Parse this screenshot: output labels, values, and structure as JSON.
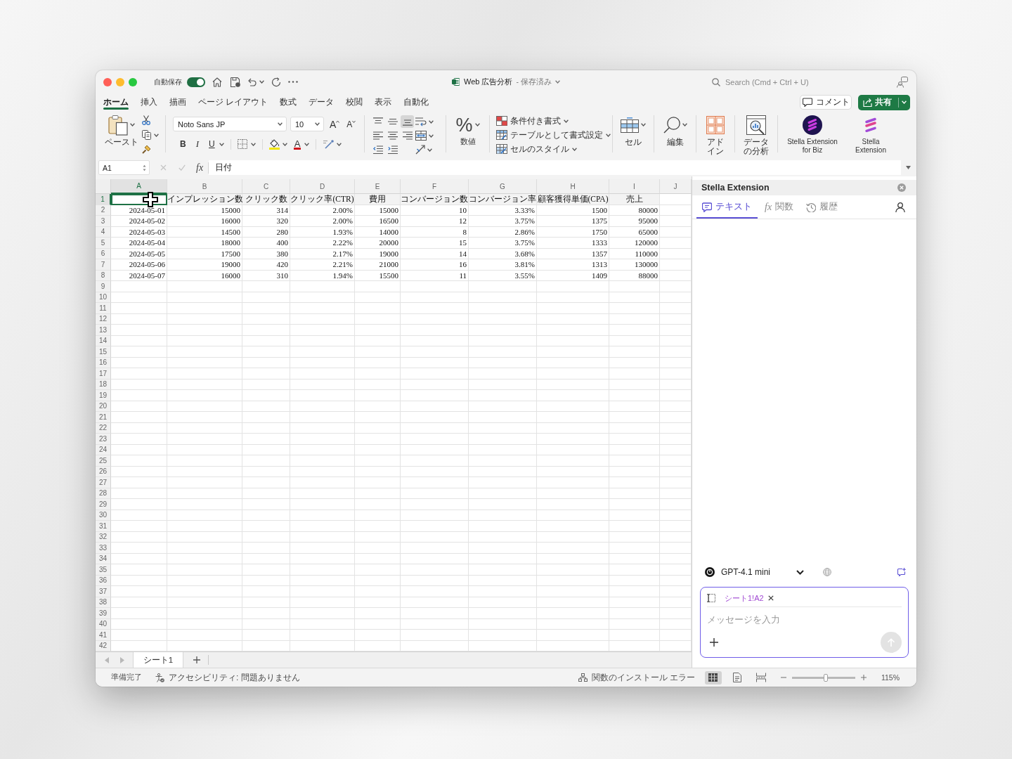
{
  "window": {
    "title": "Web 広告分析",
    "save_status": "- 保存済み",
    "autosave": {
      "label": "自動保存",
      "on": true
    },
    "search": {
      "placeholder": "Search (Cmd + Ctrl + U)"
    }
  },
  "ribbon_tabs": [
    {
      "label": "ホーム",
      "selected": true
    },
    {
      "label": "挿入",
      "selected": false
    },
    {
      "label": "描画",
      "selected": false
    },
    {
      "label": "ページ レイアウト",
      "selected": false
    },
    {
      "label": "数式",
      "selected": false
    },
    {
      "label": "データ",
      "selected": false
    },
    {
      "label": "校閲",
      "selected": false
    },
    {
      "label": "表示",
      "selected": false
    },
    {
      "label": "自動化",
      "selected": false
    }
  ],
  "comment_button": {
    "label": "コメント"
  },
  "share_button": {
    "label": "共有"
  },
  "ribbon": {
    "paste": {
      "label": "ペースト"
    },
    "font": {
      "name": "Noto Sans JP",
      "size": "10",
      "grow": "A",
      "shrink": "A",
      "bold": "B",
      "italic": "I",
      "underline": "U",
      "paint_letter": "A"
    },
    "vertical_align": [
      {
        "kind": "top",
        "selected": false
      },
      {
        "kind": "middle",
        "selected": false
      },
      {
        "kind": "bottom",
        "selected": true
      }
    ],
    "horizontal_align": [
      {
        "kind": "left",
        "selected": false
      },
      {
        "kind": "center",
        "selected": false
      },
      {
        "kind": "right",
        "selected": false
      }
    ],
    "number": {
      "symbol": "%",
      "label": "数値"
    },
    "styles": [
      {
        "kind": "conditional",
        "label": "条件付き書式"
      },
      {
        "kind": "table",
        "label": "テーブルとして書式設定"
      },
      {
        "kind": "cell",
        "label": "セルのスタイル"
      }
    ],
    "large_buttons": [
      {
        "kind": "cells",
        "label": "セル"
      },
      {
        "kind": "editing",
        "label": "編集"
      },
      {
        "kind": "addins",
        "label": "アドイン"
      },
      {
        "kind": "analysis",
        "label": "データの分析"
      },
      {
        "kind": "stella_biz",
        "label": "Stella Extension\nfor Biz"
      },
      {
        "kind": "stella",
        "label": "Stella\nExtension"
      }
    ]
  },
  "formula_bar": {
    "name_box": "A1",
    "fx_label": "fx",
    "value": "日付"
  },
  "sheet": {
    "columns": [
      "A",
      "B",
      "C",
      "D",
      "E",
      "F",
      "G",
      "H",
      "I",
      "J"
    ],
    "row_numbers": [
      "1",
      "2",
      "3",
      "4",
      "5",
      "6",
      "7",
      "8",
      "9",
      "10",
      "11",
      "12",
      "13",
      "14",
      "15",
      "16",
      "17",
      "18",
      "19",
      "20",
      "21",
      "22",
      "23",
      "24",
      "25",
      "26",
      "27",
      "28",
      "29",
      "30",
      "31",
      "32",
      "33",
      "34",
      "35",
      "36",
      "37",
      "38",
      "39",
      "40",
      "41",
      "42"
    ],
    "rows": [
      {
        "kind": "header",
        "cells": [
          {
            "selected": true
          },
          {
            "text": "インプレッション数",
            "selected": false
          },
          {
            "text": "クリック数",
            "selected": false
          },
          {
            "text": "クリック率(CTR)",
            "selected": false
          },
          {
            "text": "費用",
            "selected": false
          },
          {
            "text": "コンバージョン数",
            "selected": false
          },
          {
            "text": "コンバージョン率",
            "selected": false
          },
          {
            "text": "顧客獲得単価(CPA)",
            "selected": false
          },
          {
            "text": "売上",
            "selected": false
          }
        ]
      },
      {
        "kind": "data",
        "cells": [
          {
            "text": "2024-05-01",
            "selected": false
          },
          {
            "text": "15000",
            "selected": false
          },
          {
            "text": "314",
            "selected": false
          },
          {
            "text": "2.00%",
            "selected": false
          },
          {
            "text": "15000",
            "selected": false
          },
          {
            "text": "10",
            "selected": false
          },
          {
            "text": "3.33%",
            "selected": false
          },
          {
            "text": "1500",
            "selected": false
          },
          {
            "text": "80000",
            "selected": false
          }
        ]
      },
      {
        "kind": "data",
        "cells": [
          {
            "text": "2024-05-02",
            "selected": false
          },
          {
            "text": "16000",
            "selected": false
          },
          {
            "text": "320",
            "selected": false
          },
          {
            "text": "2.00%",
            "selected": false
          },
          {
            "text": "16500",
            "selected": false
          },
          {
            "text": "12",
            "selected": false
          },
          {
            "text": "3.75%",
            "selected": false
          },
          {
            "text": "1375",
            "selected": false
          },
          {
            "text": "95000",
            "selected": false
          }
        ]
      },
      {
        "kind": "data",
        "cells": [
          {
            "text": "2024-05-03",
            "selected": false
          },
          {
            "text": "14500",
            "selected": false
          },
          {
            "text": "280",
            "selected": false
          },
          {
            "text": "1.93%",
            "selected": false
          },
          {
            "text": "14000",
            "selected": false
          },
          {
            "text": "8",
            "selected": false
          },
          {
            "text": "2.86%",
            "selected": false
          },
          {
            "text": "1750",
            "selected": false
          },
          {
            "text": "65000",
            "selected": false
          }
        ]
      },
      {
        "kind": "data",
        "cells": [
          {
            "text": "2024-05-04",
            "selected": false
          },
          {
            "text": "18000",
            "selected": false
          },
          {
            "text": "400",
            "selected": false
          },
          {
            "text": "2.22%",
            "selected": false
          },
          {
            "text": "20000",
            "selected": false
          },
          {
            "text": "15",
            "selected": false
          },
          {
            "text": "3.75%",
            "selected": false
          },
          {
            "text": "1333",
            "selected": false
          },
          {
            "text": "120000",
            "selected": false
          }
        ]
      },
      {
        "kind": "data",
        "cells": [
          {
            "text": "2024-05-05",
            "selected": false
          },
          {
            "text": "17500",
            "selected": false
          },
          {
            "text": "380",
            "selected": false
          },
          {
            "text": "2.17%",
            "selected": false
          },
          {
            "text": "19000",
            "selected": false
          },
          {
            "text": "14",
            "selected": false
          },
          {
            "text": "3.68%",
            "selected": false
          },
          {
            "text": "1357",
            "selected": false
          },
          {
            "text": "110000",
            "selected": false
          }
        ]
      },
      {
        "kind": "data",
        "cells": [
          {
            "text": "2024-05-06",
            "selected": false
          },
          {
            "text": "19000",
            "selected": false
          },
          {
            "text": "420",
            "selected": false
          },
          {
            "text": "2.21%",
            "selected": false
          },
          {
            "text": "21000",
            "selected": false
          },
          {
            "text": "16",
            "selected": false
          },
          {
            "text": "3.81%",
            "selected": false
          },
          {
            "text": "1313",
            "selected": false
          },
          {
            "text": "130000",
            "selected": false
          }
        ]
      },
      {
        "kind": "data",
        "cells": [
          {
            "text": "2024-05-07",
            "selected": false
          },
          {
            "text": "16000",
            "selected": false
          },
          {
            "text": "310",
            "selected": false
          },
          {
            "text": "1.94%",
            "selected": false
          },
          {
            "text": "15500",
            "selected": false
          },
          {
            "text": "11",
            "selected": false
          },
          {
            "text": "3.55%",
            "selected": false
          },
          {
            "text": "1409",
            "selected": false
          },
          {
            "text": "88000",
            "selected": false
          }
        ]
      }
    ]
  },
  "sheet_tabs": [
    {
      "label": "シート1",
      "selected": true
    }
  ],
  "side_panel": {
    "title": "Stella Extension",
    "tabs": [
      {
        "kind": "text",
        "label": "テキスト",
        "selected": true
      },
      {
        "kind": "function",
        "symbol": "fx",
        "label": "関数",
        "selected": false
      },
      {
        "kind": "history",
        "label": "履歴",
        "selected": false
      }
    ],
    "model": {
      "label": "GPT-4.1 mini"
    },
    "context_chip": {
      "label": "シート1!A2"
    },
    "message": {
      "placeholder": "メッセージを入力"
    },
    "send_button": {
      "disabled": true
    }
  },
  "status_bar": {
    "ready": "準備完了",
    "accessibility": "アクセシビリティ: 問題ありません",
    "addin_error": "関数のインストール エラー",
    "views": [
      {
        "kind": "normal",
        "selected": true
      },
      {
        "kind": "page_layout",
        "selected": false
      },
      {
        "kind": "page_break",
        "selected": false
      }
    ],
    "zoom": {
      "level": 0.53,
      "reading": "115%"
    }
  }
}
